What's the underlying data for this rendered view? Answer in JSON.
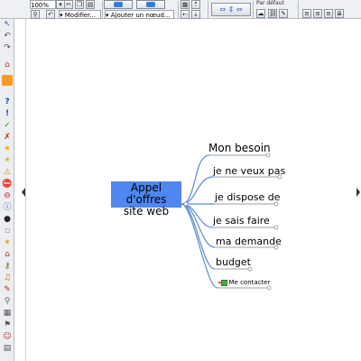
{
  "toolbar": {
    "zoom_value": "100%",
    "style_select": "Modifier...",
    "add_node_select": "Ajouter un nœud...",
    "default_select": "Par défaut"
  },
  "mindmap": {
    "root": {
      "line1": "Appel d'offres",
      "line2": "site web"
    },
    "children": [
      "Mon besoin",
      "je ne veux pas",
      "je dispose de",
      "je sais faire",
      "ma demande",
      "budget"
    ],
    "contact_link": "Me contacter"
  },
  "colors": {
    "root_bg": "#4f86f0",
    "edge": "#5b8ad6",
    "underline": "#9aa0a8"
  }
}
